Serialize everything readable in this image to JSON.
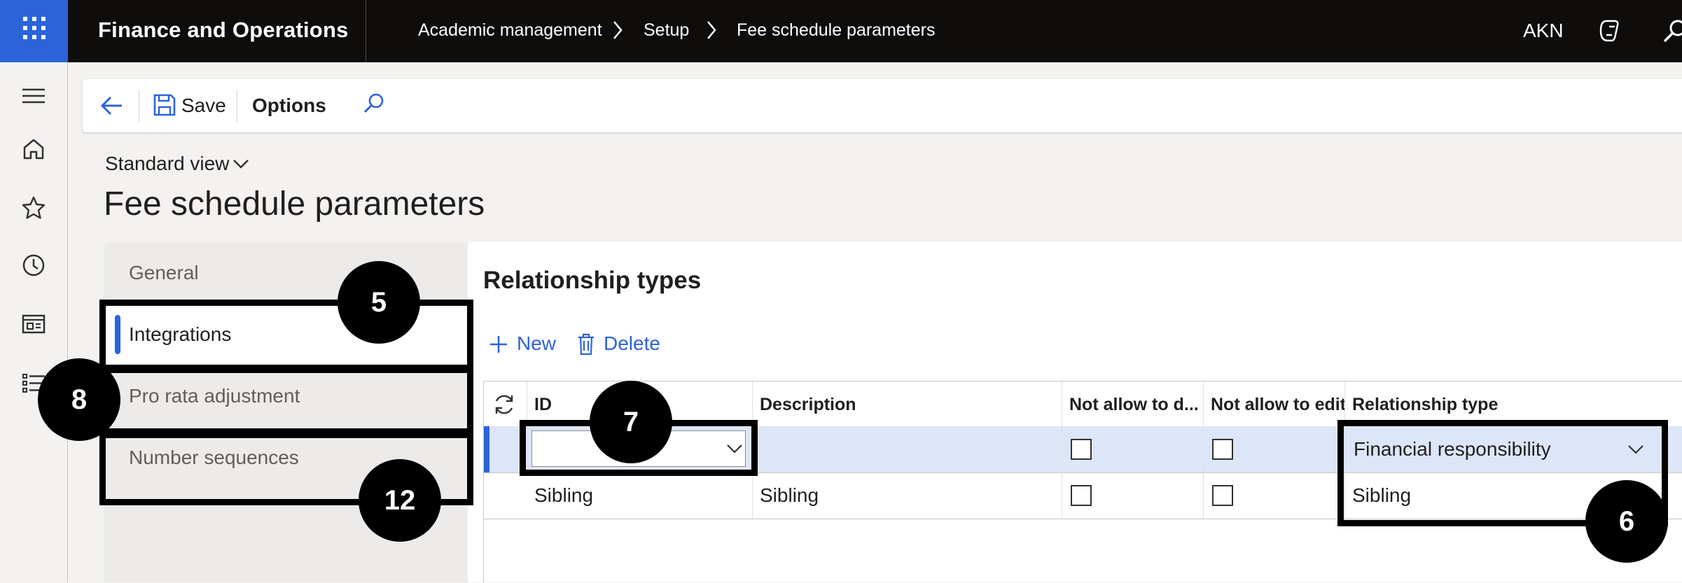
{
  "topbar": {
    "app_title": "Finance and Operations",
    "breadcrumbs": [
      "Academic management",
      "Setup",
      "Fee schedule parameters"
    ],
    "company": "AKN"
  },
  "icons": {
    "waffle": "app-launcher-icon",
    "copilot": "copilot-icon",
    "search_top": "search-icon",
    "nav": [
      "hamburger-icon",
      "home-icon",
      "star-icon",
      "clock-icon",
      "workspace-icon",
      "modules-icon"
    ]
  },
  "actionpane": {
    "save_label": "Save",
    "options_label": "Options"
  },
  "view": {
    "selector": "Standard view",
    "page_title": "Fee schedule parameters"
  },
  "tabs": [
    {
      "label": "General",
      "active": false
    },
    {
      "label": "Integrations",
      "active": true
    },
    {
      "label": "Pro rata adjustment",
      "active": false
    },
    {
      "label": "Number sequences",
      "active": false
    }
  ],
  "section": {
    "title": "Relationship types",
    "new_label": "New",
    "delete_label": "Delete"
  },
  "grid": {
    "columns": [
      "ID",
      "Description",
      "Not allow to d...",
      "Not allow to edit",
      "Relationship type"
    ],
    "rows": [
      {
        "id": "",
        "description": "",
        "not_allow_delete": false,
        "not_allow_edit": false,
        "relationship_type": "Financial responsibility",
        "selected": true
      },
      {
        "id": "Sibling",
        "description": "Sibling",
        "not_allow_delete": false,
        "not_allow_edit": false,
        "relationship_type": "Sibling",
        "selected": false
      }
    ]
  },
  "annotations": {
    "badge_5": "5",
    "badge_6": "6",
    "badge_7": "7",
    "badge_8": "8",
    "badge_12": "12"
  },
  "colors": {
    "accent": "#2b63d9",
    "topbar": "#0f0d0c",
    "selected_row": "#dde6f8"
  }
}
